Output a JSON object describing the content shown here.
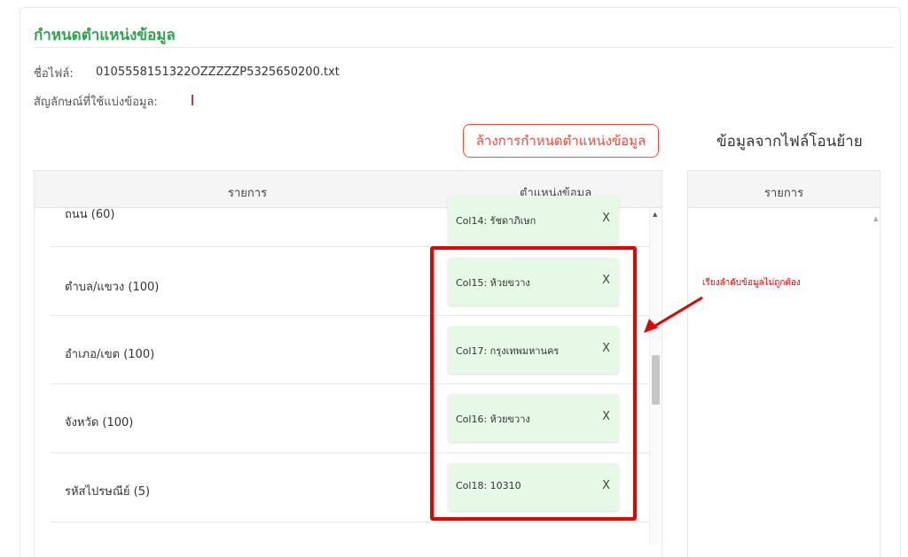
{
  "page": {
    "title": "กำหนดตำแหน่งข้อมูล",
    "file_label": "ชื่อไฟล์:",
    "file_name": "0105558151322OZZZZZP5325650200.txt",
    "delimiter_label": "สัญลักษณ์ที่ใช้แบ่งข้อมูล:",
    "clear_button": "ล้างการกำหนดตำแหน่งข้อมูล",
    "source_title": "ข้อมูลจากไฟล์โอนย้าย"
  },
  "mapping_table": {
    "headers": {
      "item": "รายการ",
      "position": "ตำแหน่งข้อมูล"
    },
    "rows": [
      {
        "label": "ถนน (60)",
        "value": "Col14: รัชดาภิเษก",
        "remove": "X"
      },
      {
        "label": "ตำบล/แขวง (100)",
        "value": "Col15: ห้วยขวาง",
        "remove": "X"
      },
      {
        "label": "อำเภอ/เขต (100)",
        "value": "Col17: กรุงเทพมหานคร",
        "remove": "X"
      },
      {
        "label": "จังหวัด (100)",
        "value": "Col16: ห้วยขวาง",
        "remove": "X"
      },
      {
        "label": "รหัสไปรษณีย์ (5)",
        "value": "Col18: 10310",
        "remove": "X"
      }
    ]
  },
  "source_table": {
    "header": "รายการ"
  },
  "annotation": {
    "error_text": "เรียงลำดับข้อมูลไม่ถูกต้อง",
    "color": "#e60000"
  },
  "colors": {
    "title_green": "#2ea44f",
    "chip_bg": "#e6f9e6",
    "button_red": "#e74c3c"
  }
}
